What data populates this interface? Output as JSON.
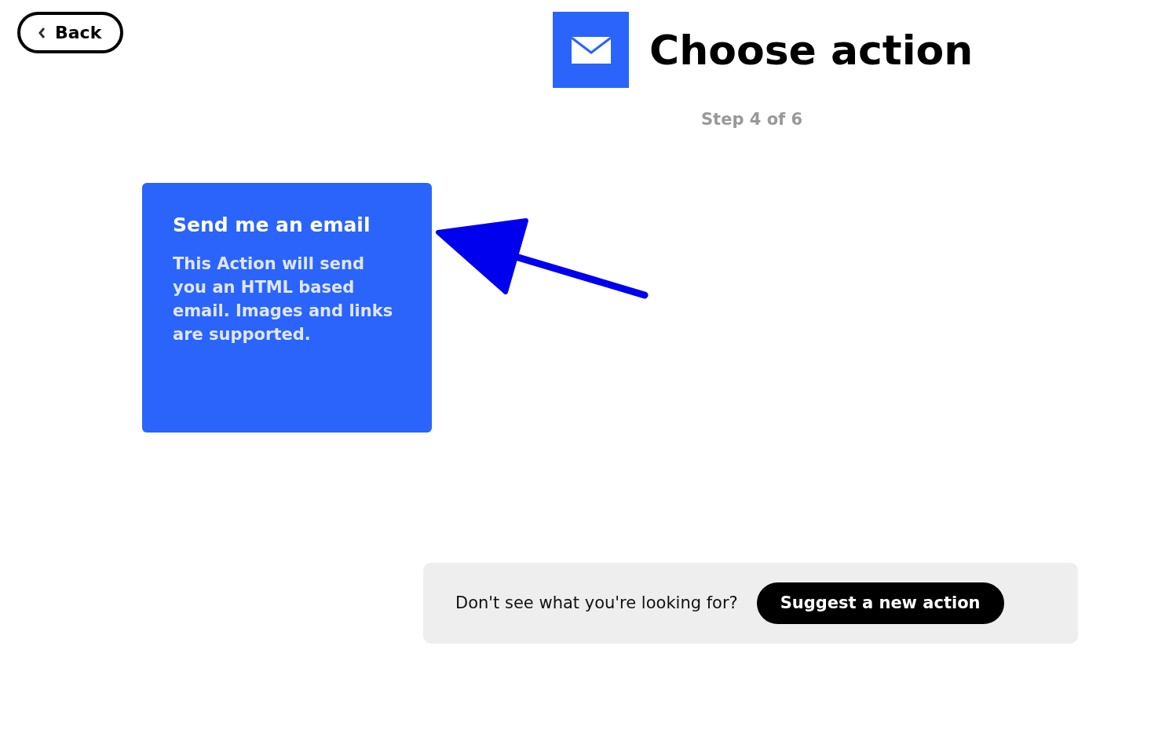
{
  "back_button": {
    "label": "Back"
  },
  "header": {
    "title": "Choose action",
    "step": "Step 4 of 6"
  },
  "actions": [
    {
      "title": "Send me an email",
      "description": "This Action will send you an HTML based email. Images and links are supported."
    }
  ],
  "footer": {
    "prompt": "Don't see what you're looking for?",
    "button": "Suggest a new action"
  }
}
